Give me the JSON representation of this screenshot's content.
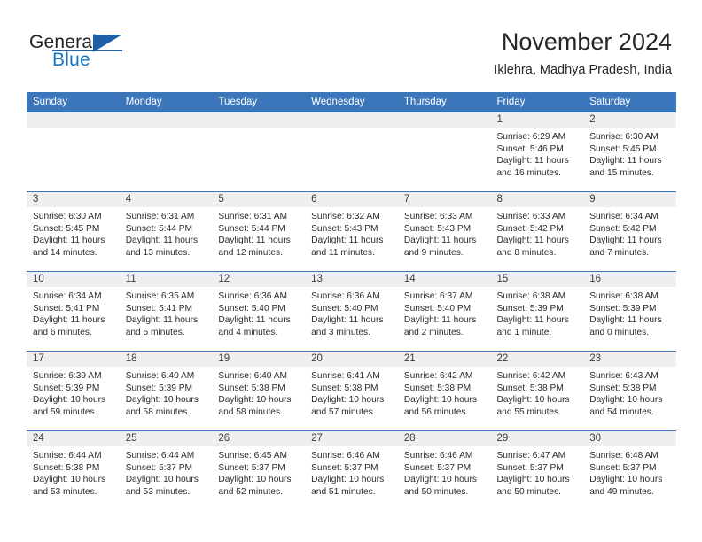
{
  "brand": {
    "name_part1": "General",
    "name_part2": "Blue",
    "logo_icon": "triangle-logo-icon"
  },
  "header": {
    "month_title": "November 2024",
    "location": "Iklehra, Madhya Pradesh, India"
  },
  "colors": {
    "header_blue": "#3a76b9",
    "brand_blue": "#1577c4",
    "logo_blue": "#1f5fa8",
    "daynum_band": "#efefef",
    "text": "#2b2b2b"
  },
  "weekday_headers": [
    "Sunday",
    "Monday",
    "Tuesday",
    "Wednesday",
    "Thursday",
    "Friday",
    "Saturday"
  ],
  "weeks": [
    [
      {
        "day": "",
        "sunrise": "",
        "sunset": "",
        "daylight_line1": "",
        "daylight_line2": "",
        "empty": true
      },
      {
        "day": "",
        "sunrise": "",
        "sunset": "",
        "daylight_line1": "",
        "daylight_line2": "",
        "empty": true
      },
      {
        "day": "",
        "sunrise": "",
        "sunset": "",
        "daylight_line1": "",
        "daylight_line2": "",
        "empty": true
      },
      {
        "day": "",
        "sunrise": "",
        "sunset": "",
        "daylight_line1": "",
        "daylight_line2": "",
        "empty": true
      },
      {
        "day": "",
        "sunrise": "",
        "sunset": "",
        "daylight_line1": "",
        "daylight_line2": "",
        "empty": true
      },
      {
        "day": "1",
        "sunrise": "Sunrise: 6:29 AM",
        "sunset": "Sunset: 5:46 PM",
        "daylight_line1": "Daylight: 11 hours",
        "daylight_line2": "and 16 minutes.",
        "empty": false
      },
      {
        "day": "2",
        "sunrise": "Sunrise: 6:30 AM",
        "sunset": "Sunset: 5:45 PM",
        "daylight_line1": "Daylight: 11 hours",
        "daylight_line2": "and 15 minutes.",
        "empty": false
      }
    ],
    [
      {
        "day": "3",
        "sunrise": "Sunrise: 6:30 AM",
        "sunset": "Sunset: 5:45 PM",
        "daylight_line1": "Daylight: 11 hours",
        "daylight_line2": "and 14 minutes.",
        "empty": false
      },
      {
        "day": "4",
        "sunrise": "Sunrise: 6:31 AM",
        "sunset": "Sunset: 5:44 PM",
        "daylight_line1": "Daylight: 11 hours",
        "daylight_line2": "and 13 minutes.",
        "empty": false
      },
      {
        "day": "5",
        "sunrise": "Sunrise: 6:31 AM",
        "sunset": "Sunset: 5:44 PM",
        "daylight_line1": "Daylight: 11 hours",
        "daylight_line2": "and 12 minutes.",
        "empty": false
      },
      {
        "day": "6",
        "sunrise": "Sunrise: 6:32 AM",
        "sunset": "Sunset: 5:43 PM",
        "daylight_line1": "Daylight: 11 hours",
        "daylight_line2": "and 11 minutes.",
        "empty": false
      },
      {
        "day": "7",
        "sunrise": "Sunrise: 6:33 AM",
        "sunset": "Sunset: 5:43 PM",
        "daylight_line1": "Daylight: 11 hours",
        "daylight_line2": "and 9 minutes.",
        "empty": false
      },
      {
        "day": "8",
        "sunrise": "Sunrise: 6:33 AM",
        "sunset": "Sunset: 5:42 PM",
        "daylight_line1": "Daylight: 11 hours",
        "daylight_line2": "and 8 minutes.",
        "empty": false
      },
      {
        "day": "9",
        "sunrise": "Sunrise: 6:34 AM",
        "sunset": "Sunset: 5:42 PM",
        "daylight_line1": "Daylight: 11 hours",
        "daylight_line2": "and 7 minutes.",
        "empty": false
      }
    ],
    [
      {
        "day": "10",
        "sunrise": "Sunrise: 6:34 AM",
        "sunset": "Sunset: 5:41 PM",
        "daylight_line1": "Daylight: 11 hours",
        "daylight_line2": "and 6 minutes.",
        "empty": false
      },
      {
        "day": "11",
        "sunrise": "Sunrise: 6:35 AM",
        "sunset": "Sunset: 5:41 PM",
        "daylight_line1": "Daylight: 11 hours",
        "daylight_line2": "and 5 minutes.",
        "empty": false
      },
      {
        "day": "12",
        "sunrise": "Sunrise: 6:36 AM",
        "sunset": "Sunset: 5:40 PM",
        "daylight_line1": "Daylight: 11 hours",
        "daylight_line2": "and 4 minutes.",
        "empty": false
      },
      {
        "day": "13",
        "sunrise": "Sunrise: 6:36 AM",
        "sunset": "Sunset: 5:40 PM",
        "daylight_line1": "Daylight: 11 hours",
        "daylight_line2": "and 3 minutes.",
        "empty": false
      },
      {
        "day": "14",
        "sunrise": "Sunrise: 6:37 AM",
        "sunset": "Sunset: 5:40 PM",
        "daylight_line1": "Daylight: 11 hours",
        "daylight_line2": "and 2 minutes.",
        "empty": false
      },
      {
        "day": "15",
        "sunrise": "Sunrise: 6:38 AM",
        "sunset": "Sunset: 5:39 PM",
        "daylight_line1": "Daylight: 11 hours",
        "daylight_line2": "and 1 minute.",
        "empty": false
      },
      {
        "day": "16",
        "sunrise": "Sunrise: 6:38 AM",
        "sunset": "Sunset: 5:39 PM",
        "daylight_line1": "Daylight: 11 hours",
        "daylight_line2": "and 0 minutes.",
        "empty": false
      }
    ],
    [
      {
        "day": "17",
        "sunrise": "Sunrise: 6:39 AM",
        "sunset": "Sunset: 5:39 PM",
        "daylight_line1": "Daylight: 10 hours",
        "daylight_line2": "and 59 minutes.",
        "empty": false
      },
      {
        "day": "18",
        "sunrise": "Sunrise: 6:40 AM",
        "sunset": "Sunset: 5:39 PM",
        "daylight_line1": "Daylight: 10 hours",
        "daylight_line2": "and 58 minutes.",
        "empty": false
      },
      {
        "day": "19",
        "sunrise": "Sunrise: 6:40 AM",
        "sunset": "Sunset: 5:38 PM",
        "daylight_line1": "Daylight: 10 hours",
        "daylight_line2": "and 58 minutes.",
        "empty": false
      },
      {
        "day": "20",
        "sunrise": "Sunrise: 6:41 AM",
        "sunset": "Sunset: 5:38 PM",
        "daylight_line1": "Daylight: 10 hours",
        "daylight_line2": "and 57 minutes.",
        "empty": false
      },
      {
        "day": "21",
        "sunrise": "Sunrise: 6:42 AM",
        "sunset": "Sunset: 5:38 PM",
        "daylight_line1": "Daylight: 10 hours",
        "daylight_line2": "and 56 minutes.",
        "empty": false
      },
      {
        "day": "22",
        "sunrise": "Sunrise: 6:42 AM",
        "sunset": "Sunset: 5:38 PM",
        "daylight_line1": "Daylight: 10 hours",
        "daylight_line2": "and 55 minutes.",
        "empty": false
      },
      {
        "day": "23",
        "sunrise": "Sunrise: 6:43 AM",
        "sunset": "Sunset: 5:38 PM",
        "daylight_line1": "Daylight: 10 hours",
        "daylight_line2": "and 54 minutes.",
        "empty": false
      }
    ],
    [
      {
        "day": "24",
        "sunrise": "Sunrise: 6:44 AM",
        "sunset": "Sunset: 5:38 PM",
        "daylight_line1": "Daylight: 10 hours",
        "daylight_line2": "and 53 minutes.",
        "empty": false
      },
      {
        "day": "25",
        "sunrise": "Sunrise: 6:44 AM",
        "sunset": "Sunset: 5:37 PM",
        "daylight_line1": "Daylight: 10 hours",
        "daylight_line2": "and 53 minutes.",
        "empty": false
      },
      {
        "day": "26",
        "sunrise": "Sunrise: 6:45 AM",
        "sunset": "Sunset: 5:37 PM",
        "daylight_line1": "Daylight: 10 hours",
        "daylight_line2": "and 52 minutes.",
        "empty": false
      },
      {
        "day": "27",
        "sunrise": "Sunrise: 6:46 AM",
        "sunset": "Sunset: 5:37 PM",
        "daylight_line1": "Daylight: 10 hours",
        "daylight_line2": "and 51 minutes.",
        "empty": false
      },
      {
        "day": "28",
        "sunrise": "Sunrise: 6:46 AM",
        "sunset": "Sunset: 5:37 PM",
        "daylight_line1": "Daylight: 10 hours",
        "daylight_line2": "and 50 minutes.",
        "empty": false
      },
      {
        "day": "29",
        "sunrise": "Sunrise: 6:47 AM",
        "sunset": "Sunset: 5:37 PM",
        "daylight_line1": "Daylight: 10 hours",
        "daylight_line2": "and 50 minutes.",
        "empty": false
      },
      {
        "day": "30",
        "sunrise": "Sunrise: 6:48 AM",
        "sunset": "Sunset: 5:37 PM",
        "daylight_line1": "Daylight: 10 hours",
        "daylight_line2": "and 49 minutes.",
        "empty": false
      }
    ]
  ]
}
